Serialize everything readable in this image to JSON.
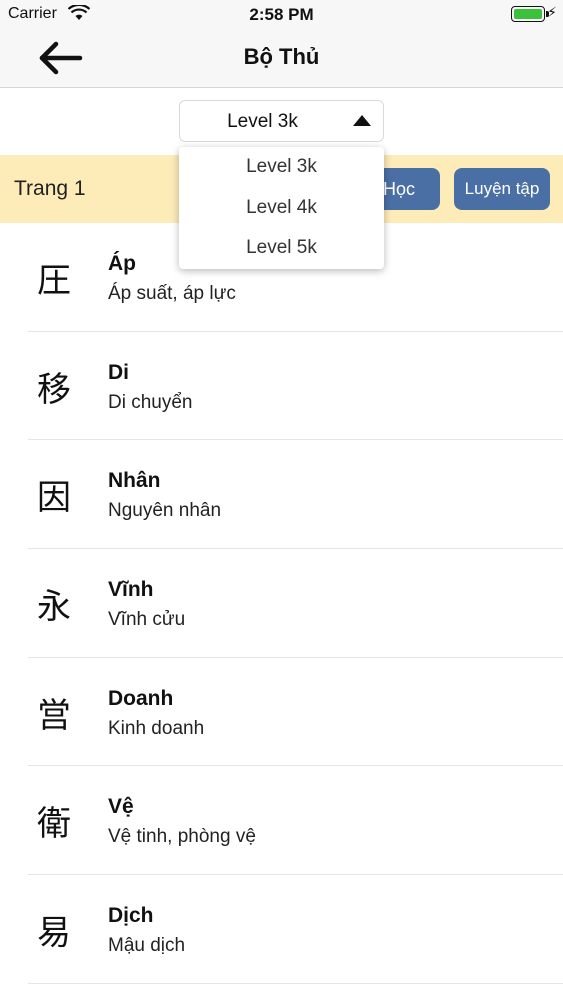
{
  "status": {
    "carrier": "Carrier",
    "time": "2:58 PM"
  },
  "nav": {
    "title": "Bộ Thủ",
    "back_icon": "arrow-left-icon"
  },
  "level": {
    "selected": "Level 3k",
    "options": [
      "Level 3k",
      "Level 4k",
      "Level 5k"
    ]
  },
  "toolbar": {
    "page_label": "Trang 1",
    "learn_label": "Học",
    "practice_label": "Luyện tập",
    "button_color": "#4a6fa5",
    "background": "#fdebb8"
  },
  "items": [
    {
      "kanji": "圧",
      "word": "Áp",
      "meaning": "Áp suất, áp lực"
    },
    {
      "kanji": "移",
      "word": "Di",
      "meaning": "Di chuyển"
    },
    {
      "kanji": "因",
      "word": "Nhân",
      "meaning": "Nguyên nhân"
    },
    {
      "kanji": "永",
      "word": "Vĩnh",
      "meaning": "Vĩnh cửu"
    },
    {
      "kanji": "営",
      "word": "Doanh",
      "meaning": "Kinh doanh"
    },
    {
      "kanji": "衛",
      "word": "Vệ",
      "meaning": "Vệ tinh, phòng vệ"
    },
    {
      "kanji": "易",
      "word": "Dịch",
      "meaning": "Mậu dịch"
    }
  ]
}
